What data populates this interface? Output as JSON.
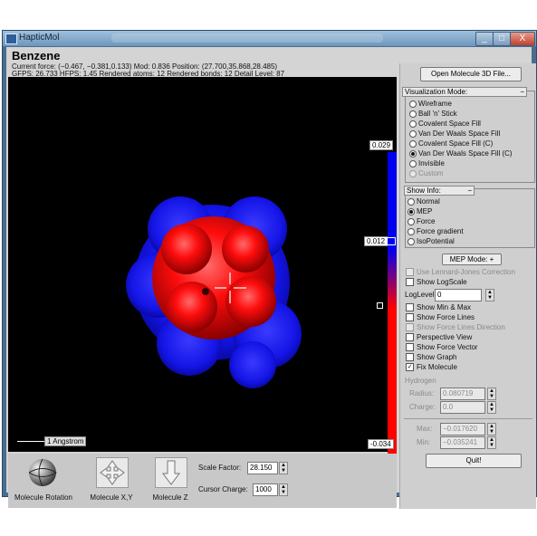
{
  "window": {
    "title": "HapticMol",
    "buttons": [
      "_",
      "□",
      "X"
    ]
  },
  "header": {
    "molecule": "Benzene",
    "line1": "Current force: (−0.467, −0.381,0.133) Mod: 0.836  Position: (27.700,35.868,28.485)",
    "line2": "GFPS: 26.733  HFPS: 1.45  Rendered atoms: 12  Rendered bonds: 12  Detail Level: 87"
  },
  "scale": {
    "max": "0.029",
    "mid": "0.012",
    "min": "-0.034"
  },
  "ruler_label": "1 Angstrom",
  "toolbar": {
    "rotation": "Molecule Rotation",
    "xy": "Molecule X,Y",
    "z": "Molecule Z",
    "scale_factor_label": "Scale Factor:",
    "scale_factor_value": "28.150",
    "cursor_charge_label": "Cursor Charge:",
    "cursor_charge_value": "1000"
  },
  "panel": {
    "open_button": "Open Molecule 3D File...",
    "vis_mode_title": "Visualization Mode:",
    "vis_modes": [
      {
        "label": "Wireframe",
        "selected": false,
        "disabled": false
      },
      {
        "label": "Ball 'n' Stick",
        "selected": false,
        "disabled": false
      },
      {
        "label": "Covalent Space Fill",
        "selected": false,
        "disabled": false
      },
      {
        "label": "Van Der Waals Space Fill",
        "selected": false,
        "disabled": false
      },
      {
        "label": "Covalent Space Fill (C)",
        "selected": false,
        "disabled": false
      },
      {
        "label": "Van Der Waals Space Fill (C)",
        "selected": true,
        "disabled": false
      },
      {
        "label": "Invisible",
        "selected": false,
        "disabled": false
      },
      {
        "label": "Custom",
        "selected": false,
        "disabled": true
      }
    ],
    "show_info_title": "Show Info:",
    "show_info": [
      {
        "label": "Normal",
        "selected": false
      },
      {
        "label": "MEP",
        "selected": true
      },
      {
        "label": "Force",
        "selected": false
      },
      {
        "label": "Force gradient",
        "selected": false
      },
      {
        "label": "IsoPotential",
        "selected": false
      }
    ],
    "mep_mode": "MEP Mode: +",
    "options_a": [
      {
        "label": "Use Lennard-Jones Correction",
        "checked": false,
        "disabled": true
      },
      {
        "label": "Show LogScale",
        "checked": false,
        "disabled": false
      }
    ],
    "loglevel_label": "LogLevel",
    "loglevel_value": "0",
    "options_b": [
      {
        "label": "Show Min & Max",
        "checked": false,
        "disabled": false
      },
      {
        "label": "Show Force Lines",
        "checked": false,
        "disabled": false
      },
      {
        "label": "Show Force Lines Direction",
        "checked": false,
        "disabled": true
      },
      {
        "label": "Perspective View",
        "checked": false,
        "disabled": false
      },
      {
        "label": "Show Force Vector",
        "checked": false,
        "disabled": false
      },
      {
        "label": "Show Graph",
        "checked": false,
        "disabled": false
      },
      {
        "label": "Fix Molecule",
        "checked": true,
        "disabled": false
      }
    ],
    "hydrogen_label": "Hydrogen",
    "radius_label": "Radius:",
    "radius_value": "0.080719",
    "charge_label": "Charge:",
    "charge_value": "0.0",
    "max_label": "Max:",
    "max_value": "−0.017620",
    "min_label": "Min:",
    "min_value": "−0.035241",
    "quit_button": "Quit!"
  }
}
